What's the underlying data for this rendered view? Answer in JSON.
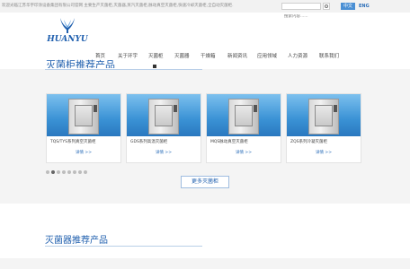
{
  "topbar": {
    "notice": "欢迎光临江苏华宇印涂设备集团有限公司官网 主要生产灭菌柜,灭菌器,蒸汽灭菌柜,脉动真空灭菌柜,快速冷却灭菌柜,全自动灭菌柜.",
    "search_placeholder": "搜索内容......",
    "lang_cn": "中文",
    "lang_en": "ENG"
  },
  "brand": {
    "logo_text": "HUANYU",
    "logo_color": "#1f5fae"
  },
  "nav": {
    "items": [
      {
        "label": "首页"
      },
      {
        "label": "关于环宇"
      },
      {
        "label": "灭菌柜"
      },
      {
        "label": "灭菌器"
      },
      {
        "label": "干燥箱"
      },
      {
        "label": "新闻资讯"
      },
      {
        "label": "应用领域"
      },
      {
        "label": "人力资源"
      },
      {
        "label": "联系我们"
      }
    ]
  },
  "section1": {
    "title": "灭菌柜推荐产品"
  },
  "products": [
    {
      "name": "TQS/TYS系列真空灭菌柜",
      "more": "详情 >>"
    },
    {
      "name": "GDS系列高温灭菌柜",
      "more": "详情 >>"
    },
    {
      "name": "MQS脉动真空灭菌柜",
      "more": "详情 >>"
    },
    {
      "name": "ZQS系列冷凝灭菌柜",
      "more": "详情 >>"
    }
  ],
  "carousel": {
    "count": 8,
    "active_index": 1
  },
  "more_button": "更多灭菌柜",
  "section2": {
    "title": "灭菌器推荐产品"
  },
  "colors": {
    "accent": "#1f5fae",
    "lang_active_bg": "#4a8fd4",
    "band_bg": "#f4f4f4"
  }
}
